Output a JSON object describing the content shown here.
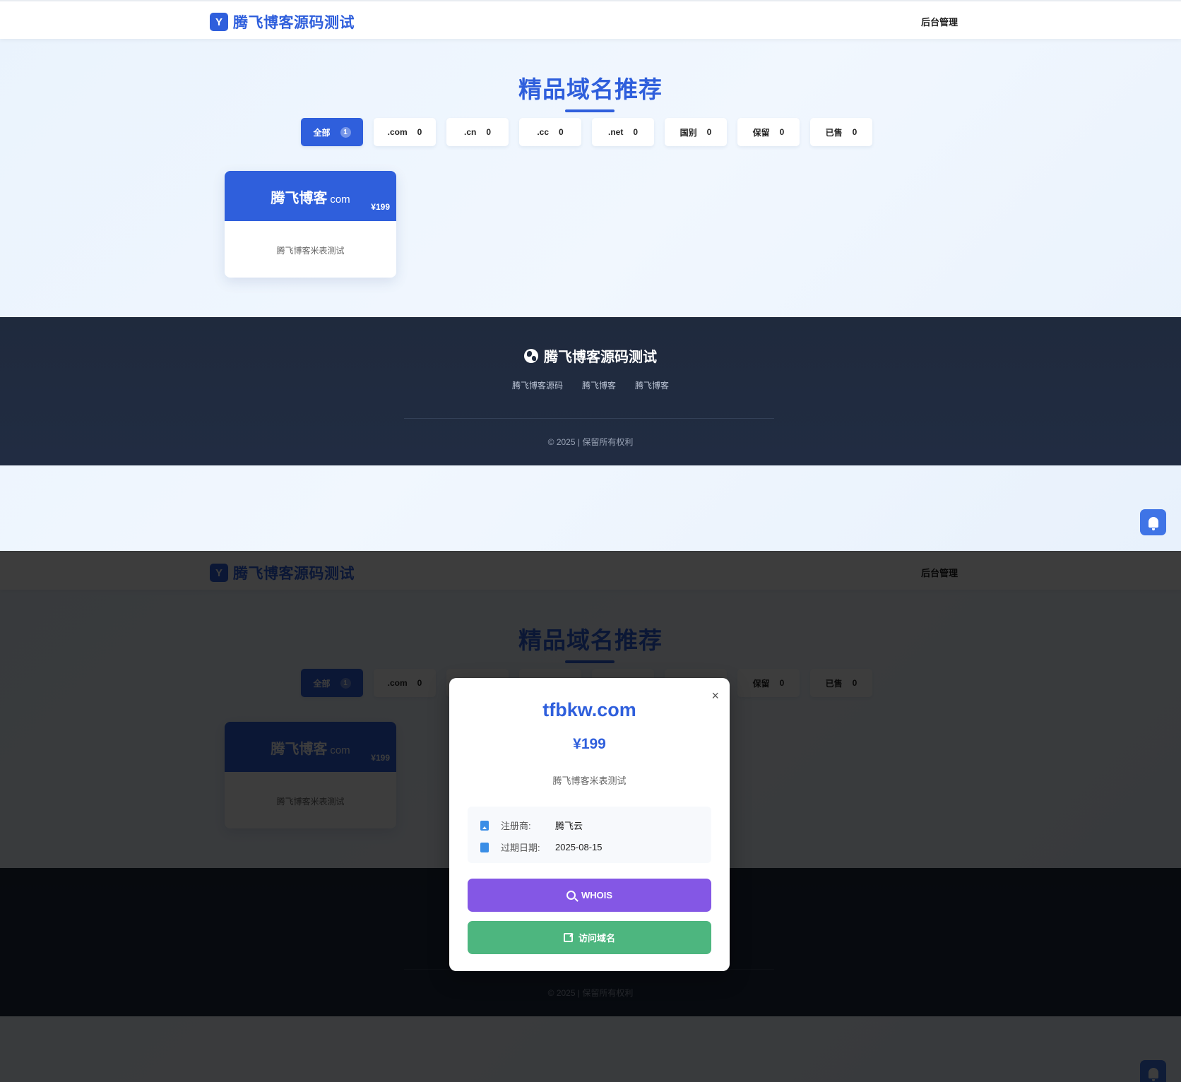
{
  "header": {
    "logo_badge": "Y",
    "site_name": "腾飞博客源码测试",
    "admin_link": "后台管理"
  },
  "hero": {
    "title": "精品域名推荐"
  },
  "filters": [
    {
      "label": "全部",
      "count": "1",
      "active": true
    },
    {
      "label": ".com",
      "count": "0"
    },
    {
      "label": ".cn",
      "count": "0"
    },
    {
      "label": ".cc",
      "count": "0"
    },
    {
      "label": ".net",
      "count": "0"
    },
    {
      "label": "国别",
      "count": "0"
    },
    {
      "label": "保留",
      "count": "0"
    },
    {
      "label": "已售",
      "count": "0"
    }
  ],
  "domain_card": {
    "name": "腾飞博客",
    "tld": "com",
    "price": "¥199",
    "description": "腾飞博客米表测试"
  },
  "footer": {
    "title": "腾飞博客源码测试",
    "links": [
      "腾飞博客源码",
      "腾飞博客",
      "腾飞博客"
    ],
    "copyright": "© 2025 | 保留所有权利"
  },
  "modal": {
    "close": "×",
    "domain": "tfbkw.com",
    "price": "¥199",
    "description": "腾飞博客米表测试",
    "registrar_label": "注册商:",
    "registrar_value": "腾飞云",
    "expiry_label": "过期日期:",
    "expiry_value": "2025-08-15",
    "whois_button": "WHOIS",
    "visit_button": "访问域名"
  },
  "colors": {
    "primary": "#2f5fdc",
    "footer_bg": "#1f2a3d",
    "whois": "#8457e5",
    "visit": "#4db67f"
  }
}
